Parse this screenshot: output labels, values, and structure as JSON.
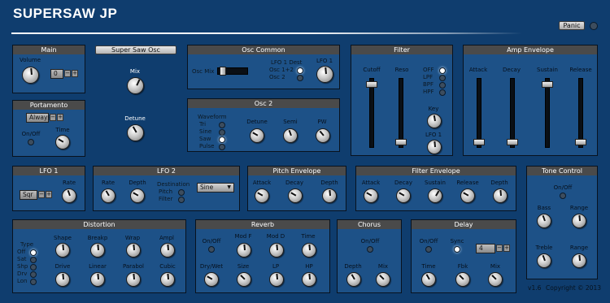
{
  "app": {
    "title": "SUPERSAW JP",
    "panic": "Panic",
    "osc_label": "Super Saw Osc",
    "version": "v1.6",
    "copyright": "Copyright © 2013"
  },
  "main": {
    "title": "Main",
    "volume": "Volume",
    "octave": "0"
  },
  "portamento": {
    "title": "Portamento",
    "mode": "Always",
    "onoff": "On/Off",
    "time": "Time"
  },
  "osc": {
    "mix": "Mix",
    "detune": "Detune"
  },
  "osc_common": {
    "title": "Osc Common",
    "osc_mix": "Osc Mix",
    "dest_title": "LFO 1 Dest",
    "dest": [
      "Osc 1+2",
      "Osc 2"
    ],
    "lfo1": "LFO 1"
  },
  "osc2": {
    "title": "Osc 2",
    "waveform": "Waveform",
    "waves": [
      "Tri",
      "Sine",
      "Saw",
      "Pulse"
    ],
    "detune": "Detune",
    "semi": "Semi",
    "pw": "PW"
  },
  "filter": {
    "title": "Filter",
    "cutoff": "Cutoff",
    "reso": "Reso",
    "types": [
      "OFF",
      "LPF",
      "BPF",
      "HPF"
    ],
    "key": "Key",
    "lfo1": "LFO 1"
  },
  "amp": {
    "title": "Amp Envelope",
    "attack": "Attack",
    "decay": "Decay",
    "sustain": "Sustain",
    "release": "Release"
  },
  "lfo1": {
    "title": "LFO 1",
    "shape": "Sqr",
    "rate": "Rate"
  },
  "lfo2": {
    "title": "LFO 2",
    "rate": "Rate",
    "depth": "Depth",
    "dest_title": "Destination",
    "dest": [
      "Pitch",
      "Filter"
    ],
    "shape": "Sine"
  },
  "pitch_env": {
    "title": "Pitch Envelope",
    "attack": "Attack",
    "decay": "Decay",
    "depth": "Depth"
  },
  "filter_env": {
    "title": "Filter Envelope",
    "attack": "Attack",
    "decay": "Decay",
    "sustain": "Sustain",
    "release": "Release",
    "depth": "Depth"
  },
  "tone": {
    "title": "Tone Control",
    "onoff": "On/Off",
    "bass": "Bass",
    "range1": "Range",
    "treble": "Treble",
    "range2": "Range"
  },
  "distortion": {
    "title": "Distortion",
    "type": "Type",
    "types": [
      "Off",
      "Sat",
      "Shp",
      "Drv",
      "Lon"
    ],
    "shape": "Shape",
    "breakp": "Breakp",
    "wrap": "Wrap",
    "ampl": "Ampl",
    "drive": "Drive",
    "linear": "Linear",
    "parabol": "Parabol",
    "cubic": "Cubic"
  },
  "reverb": {
    "title": "Reverb",
    "onoff": "On/Off",
    "modf": "Mod F",
    "modd": "Mod D",
    "time": "Time",
    "drywet": "Dry/Wet",
    "size": "Size",
    "lp": "LP",
    "hp": "HP"
  },
  "chorus": {
    "title": "Chorus",
    "onoff": "On/Off",
    "depth": "Depth",
    "mix": "Mix"
  },
  "delay": {
    "title": "Delay",
    "onoff": "On/Off",
    "sync": "Sync",
    "div": "4",
    "time": "Time",
    "fbk": "Fbk",
    "mix": "Mix"
  }
}
